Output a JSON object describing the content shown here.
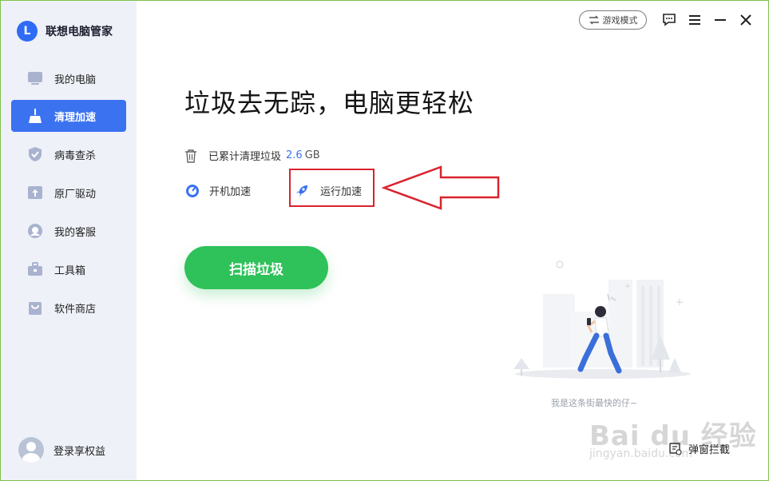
{
  "app": {
    "logo_letter": "L",
    "title": "联想电脑管家"
  },
  "sidebar": {
    "items": [
      {
        "label": "我的电脑",
        "icon": "computer-icon"
      },
      {
        "label": "清理加速",
        "icon": "broom-icon",
        "active": true
      },
      {
        "label": "病毒查杀",
        "icon": "shield-icon"
      },
      {
        "label": "原厂驱动",
        "icon": "driver-icon"
      },
      {
        "label": "我的客服",
        "icon": "headset-icon"
      },
      {
        "label": "工具箱",
        "icon": "toolbox-icon"
      },
      {
        "label": "软件商店",
        "icon": "shopping-bag-icon"
      }
    ],
    "login_label": "登录享权益"
  },
  "topbar": {
    "game_mode_label": "游戏模式"
  },
  "main": {
    "headline": "垃圾去无踪，电脑更轻松",
    "stat_label": "已累计清理垃圾",
    "stat_value": "2.6",
    "stat_unit": "GB",
    "boot_boost_label": "开机加速",
    "run_boost_label": "运行加速",
    "scan_button": "扫描垃圾",
    "caption": "我是这条街最快的仔~",
    "popup_block_label": "弹窗拦截"
  },
  "watermark": {
    "brand": "Bai du 经验",
    "url": "jingyan.baidu.com"
  },
  "colors": {
    "accent": "#3b72f0",
    "scan_green": "#2fc15a",
    "annotation_red": "#d9232e",
    "sidebar_bg": "#eef1f8"
  }
}
